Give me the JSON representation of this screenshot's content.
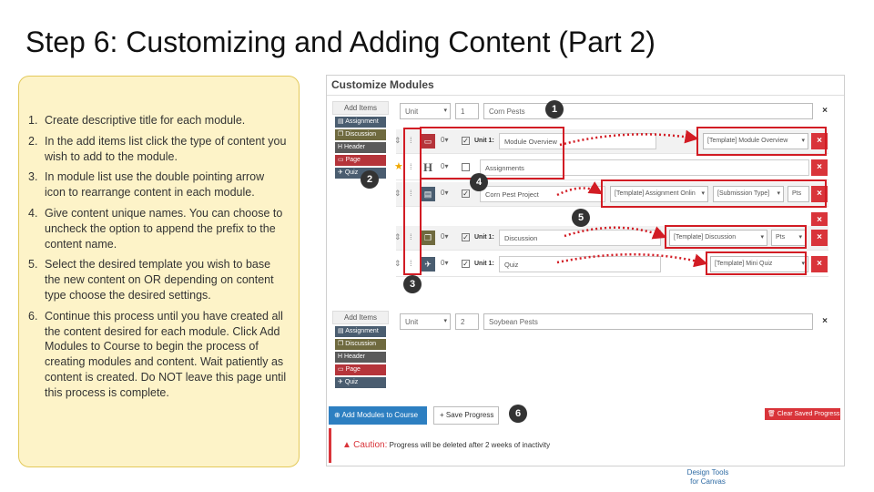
{
  "title": "Step 6: Customizing and Adding Content (Part 2)",
  "instructions": [
    {
      "num": "1.",
      "text": "Create descriptive title for each module."
    },
    {
      "num": "2.",
      "text": "In the add items list click the type of content you wish to add to the module."
    },
    {
      "num": "3.",
      "text": "In module list use the double pointing arrow icon to rearrange content in each module."
    },
    {
      "num": "4.",
      "text": "Give content unique names.  You can choose to uncheck the option to append the prefix to the content name."
    },
    {
      "num": "5.",
      "text": "Select the desired template you wish to base the new content on OR depending on content type choose the desired settings."
    },
    {
      "num": "6.",
      "text": "Continue this process until you have created all the content desired for each module. Click Add Modules to Course to begin the process of creating modules and content. Wait patiently as content is created. Do NOT leave this page until this process is complete."
    }
  ],
  "panel": {
    "title": "Customize Modules",
    "add_items": {
      "title": "Add Items",
      "assignment": "Assignment",
      "discussion": "Discussion",
      "header": "Header",
      "page": "Page",
      "quiz": "Quiz"
    },
    "module1": {
      "type": "Unit",
      "number": "1",
      "name": "Corn Pests",
      "items": [
        {
          "unit_label": "Unit 1:",
          "name": "Module Overview",
          "template": "[Template] Module Overview"
        },
        {
          "unit_label": "",
          "name": "Assignments"
        },
        {
          "unit_label": "",
          "name": "Corn Pest Project",
          "template": "[Template] Assignment Onlin",
          "submission": "[Submission Type]",
          "points": "Pts"
        },
        {
          "unit_label": "Unit 1:",
          "name": "Discussion",
          "template": "[Template] Discussion",
          "points": "Pts"
        },
        {
          "unit_label": "Unit 1:",
          "name": "Quiz",
          "template": "[Template] Mini Quiz"
        }
      ]
    },
    "module2": {
      "type": "Unit",
      "number": "2",
      "name": "Soybean Pests"
    },
    "buttons": {
      "add_modules": "Add Modules to Course",
      "save_progress": "+ Save Progress",
      "clear_progress": "Clear Saved Progress"
    },
    "caution": {
      "title": "Caution:",
      "text": "Progress will be deleted after 2 weeks of inactivity"
    },
    "badges": [
      "1",
      "2",
      "3",
      "4",
      "5",
      "6"
    ]
  },
  "footer": {
    "line1": "Design Tools",
    "line2": "for Canvas"
  },
  "colors": {
    "highlight": "#d21c24",
    "primary": "#2d7fc1",
    "danger": "#d9343a",
    "note_bg": "#fdf3c8"
  }
}
